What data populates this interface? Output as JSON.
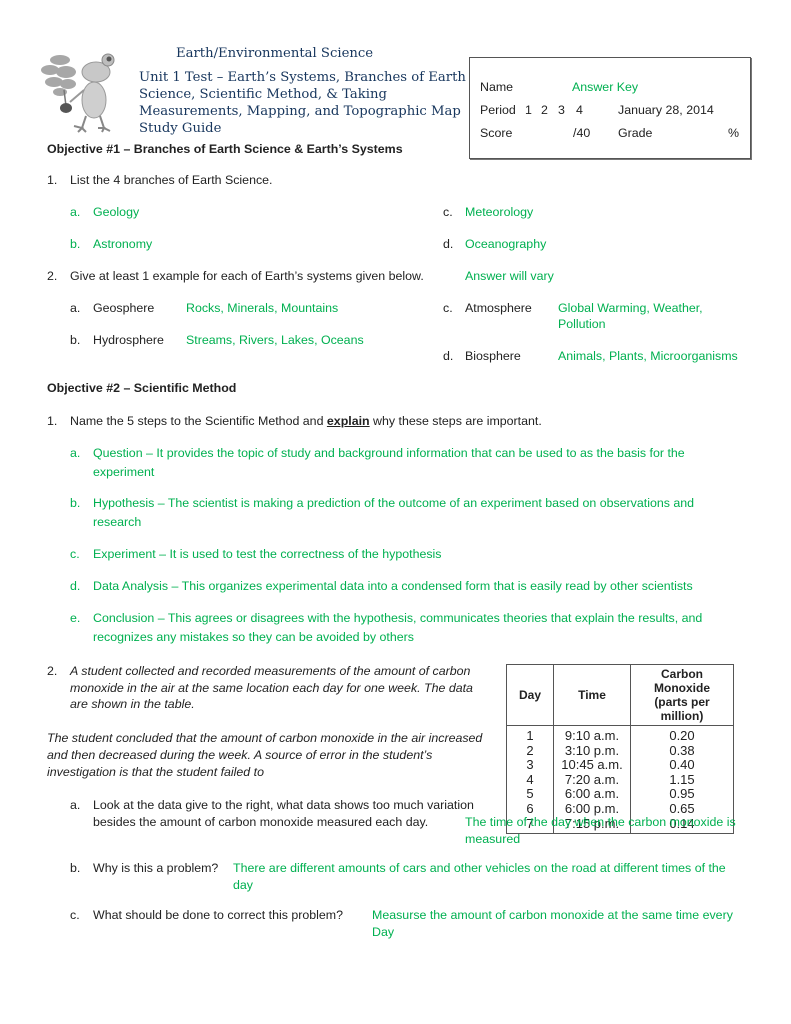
{
  "header": {
    "logo_icon": "frog-holding-plant-icon",
    "subject": "Earth/Environmental Science",
    "title": "Unit 1 Test – Earth’s Systems, Branches of Earth Science, Scientific Method, & Taking Measurements, Mapping, and Topographic Map Study Guide"
  },
  "infobox": {
    "name_label": "Name",
    "name_value": "Answer Key",
    "period_label": "Period",
    "period_options": [
      "1",
      "2",
      "3",
      "4"
    ],
    "date": "January 28, 2014",
    "score_label": "Score",
    "score_value": "/40",
    "grade_label": "Grade",
    "grade_suffix": "%"
  },
  "objective1": {
    "heading": "Objective #1 – Branches of Earth Science & Earth’s Systems",
    "q1": {
      "number": "1.",
      "text": "List the 4 branches of Earth Science.",
      "answers": [
        {
          "letter": "a.",
          "text": "Geology"
        },
        {
          "letter": "b.",
          "text": "Astronomy"
        },
        {
          "letter": "c.",
          "text": "Meteorology"
        },
        {
          "letter": "d.",
          "text": "Oceanography"
        }
      ]
    },
    "q2": {
      "number": "2.",
      "text": "Give at least 1 example for each of Earth’s systems given below.",
      "note": "Answer will vary",
      "items": [
        {
          "letter": "a.",
          "label": "Geosphere",
          "answer": "Rocks, Minerals, Mountains"
        },
        {
          "letter": "b.",
          "label": "Hydrosphere",
          "answer": "Streams, Rivers, Lakes, Oceans"
        },
        {
          "letter": "c.",
          "label": "Atmosphere",
          "answer_line1": "Global Warming, Weather,",
          "answer_line2": "Pollution"
        },
        {
          "letter": "d.",
          "label": "Biosphere",
          "answer": "Animals, Plants, Microorganisms"
        }
      ]
    }
  },
  "objective2": {
    "heading": "Objective #2 – Scientific Method",
    "q1": {
      "number": "1.",
      "text_before": "Name the 5 steps to the Scientific Method and ",
      "text_emphasis": "explain",
      "text_after": " why these steps are important.",
      "answers": [
        {
          "letter": "a.",
          "line1": "Question – It provides the topic of study and background information that can be used to as the basis for the",
          "line2": "experiment"
        },
        {
          "letter": "b.",
          "line1": "Hypothesis – The scientist is making a prediction of the outcome of an experiment based on observations and",
          "line2": "research"
        },
        {
          "letter": "c.",
          "line1": "Experiment – It is used to test the correctness of the hypothesis"
        },
        {
          "letter": "d.",
          "line1": "Data Analysis – This organizes experimental data into a condensed form that is easily read by other scientists"
        },
        {
          "letter": "e.",
          "line1": "Conclusion – This agrees or disagrees with the hypothesis, communicates theories that explain the results, and",
          "line2": "recognizes any mistakes so they can be avoided by others"
        }
      ]
    },
    "q2": {
      "number": "2.",
      "prompt_lines": [
        "A student collected and recorded measurements of the amount of carbon",
        "monoxide in the air at the same location each day for one week.  The data",
        "are shown in the table."
      ],
      "conclusion_lines": [
        "The student concluded that the amount of carbon monoxide in the air increased",
        "and then decreased during the week. A source of error in the student’s",
        "investigation is that the student failed to"
      ],
      "table": {
        "headers": [
          "Day",
          "Time",
          "Carbon Monoxide\n(parts per million)"
        ],
        "header_co_line1": "Carbon Monoxide",
        "header_co_line2": "(parts per million)",
        "rows": [
          [
            "1",
            "9:10 a.m.",
            "0.20"
          ],
          [
            "2",
            "3:10 p.m.",
            "0.38"
          ],
          [
            "3",
            "10:45 a.m.",
            "0.40"
          ],
          [
            "4",
            "7:20 a.m.",
            "1.15"
          ],
          [
            "5",
            "6:00 a.m.",
            "0.95"
          ],
          [
            "6",
            "6:00 p.m.",
            "0.65"
          ],
          [
            "7",
            "7:15 p.m.",
            "0.14"
          ]
        ]
      },
      "subs": [
        {
          "letter": "a.",
          "q_line1": "Look at the data give to the right, what data shows too much variation",
          "q_line2": "besides the amount of carbon monoxide measured each day.",
          "a_line1": "The time of the day when the carbon monoxide is",
          "a_line2": "measured"
        },
        {
          "letter": "b.",
          "q_line1": "Why is this a problem?",
          "a_line1": "There are different amounts of cars and other vehicles on the road at different times of the",
          "a_line2": "day"
        },
        {
          "letter": "c.",
          "q_line1": "What should be done to correct this problem?",
          "a_line1": "Measurse the amount of carbon monoxide at the same time every",
          "a_line2": "Day"
        }
      ]
    }
  },
  "colors": {
    "answer_green": "#00b050",
    "title_blue": "#17365d",
    "text": "#222222"
  }
}
